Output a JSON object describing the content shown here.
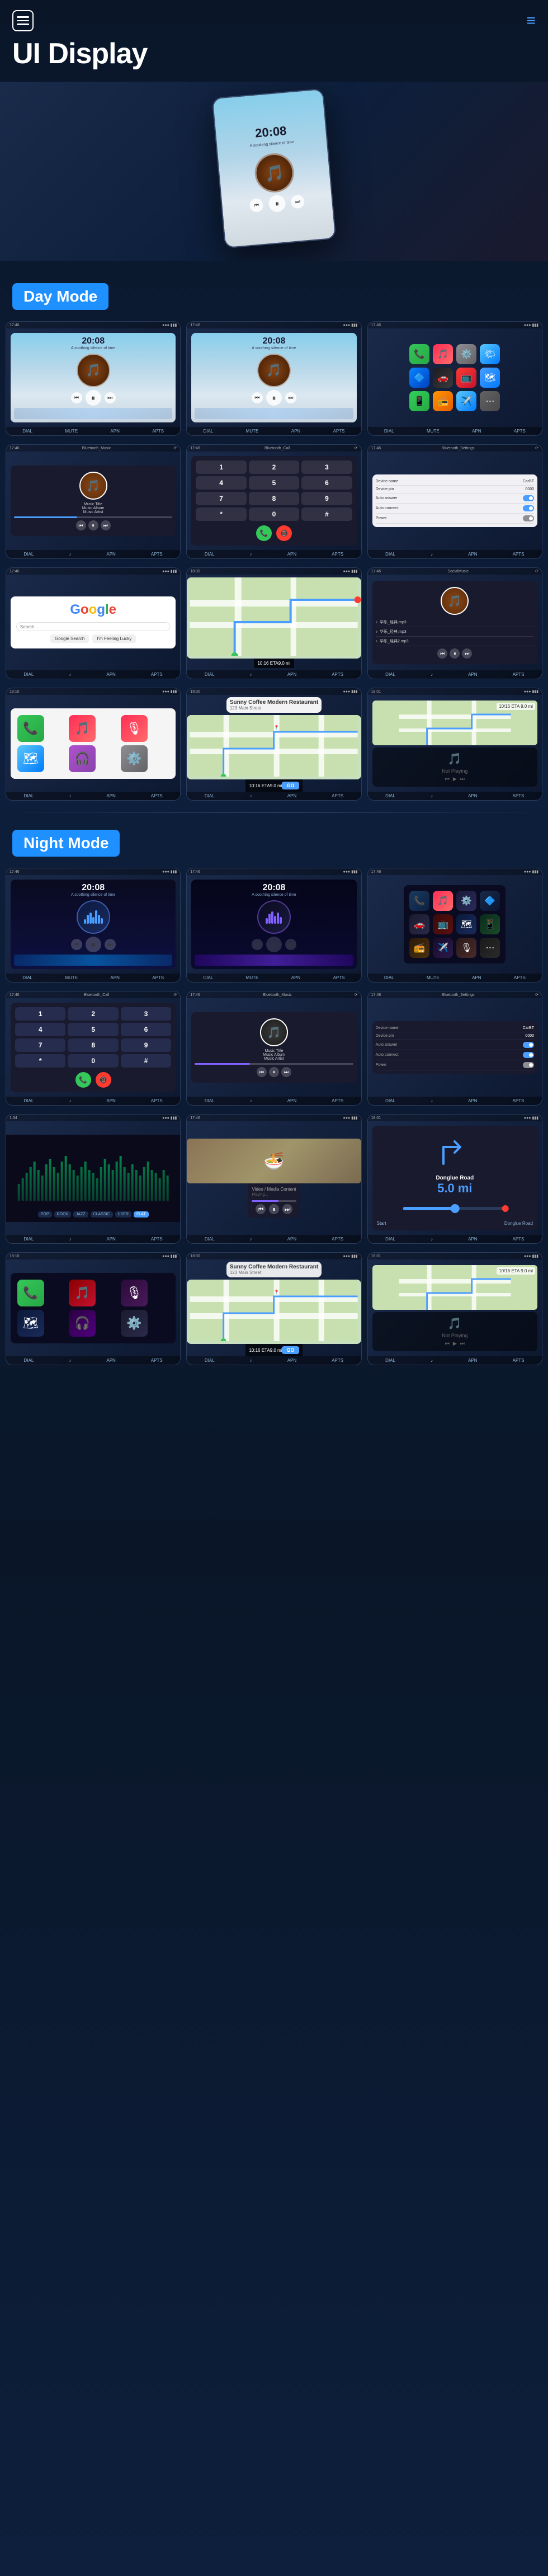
{
  "header": {
    "title": "UI Display",
    "menu_label": "menu",
    "nav_icon": "≡"
  },
  "sections": {
    "day_mode": "Day Mode",
    "night_mode": "Night Mode"
  },
  "day_mode": {
    "screens": [
      {
        "id": "day-music-1",
        "type": "music",
        "time": "20:08",
        "subtitle": "A soothing silence of time"
      },
      {
        "id": "day-music-2",
        "type": "music",
        "time": "20:08",
        "subtitle": "A soothing silence of time"
      },
      {
        "id": "day-apps",
        "type": "apps"
      }
    ]
  },
  "music_player": {
    "title": "Music Title",
    "album": "Music Album",
    "artist": "Music Artist",
    "album_art_icon": "🎵"
  },
  "phone": {
    "numbers": [
      "1",
      "2",
      "3",
      "4",
      "5",
      "6",
      "7",
      "8",
      "9",
      "*",
      "0",
      "#"
    ]
  },
  "settings": {
    "title": "Bluetooth_Settings",
    "rows": [
      {
        "label": "Device name",
        "value": "CarBT"
      },
      {
        "label": "Device pin",
        "value": "0000"
      },
      {
        "label": "Auto answer",
        "value": "toggle"
      },
      {
        "label": "Auto connect",
        "value": "toggle"
      },
      {
        "label": "Power",
        "value": "toggle"
      }
    ]
  },
  "google": {
    "logo": "Google",
    "search_placeholder": "Search..."
  },
  "map": {
    "eta": "10:16 ETA",
    "distance": "9.0 mi"
  },
  "social_music": {
    "title": "SocialMusic",
    "tracks": [
      "华乐_经典.mp3",
      "华乐_经典.mp3",
      "华乐_经典2.mp3"
    ]
  },
  "coffee_shop": {
    "name": "Sunny Coffee Modern Restaurant",
    "address": "123 Main Street",
    "eta": "10:16 ETA",
    "distance": "9.0 mi",
    "go_btn": "GO"
  },
  "navigation": {
    "road": "Donglue Road",
    "distance": "5.0 mi",
    "not_playing": "Not Playing"
  },
  "nav_bar_items": [
    "DIAL",
    "MUTE",
    "APN",
    "APTS",
    "⊕",
    "〓"
  ],
  "status": {
    "time": "17:46",
    "signal": "●●●",
    "battery": "▮▮▮"
  },
  "night_mode_label": "Night Mode"
}
